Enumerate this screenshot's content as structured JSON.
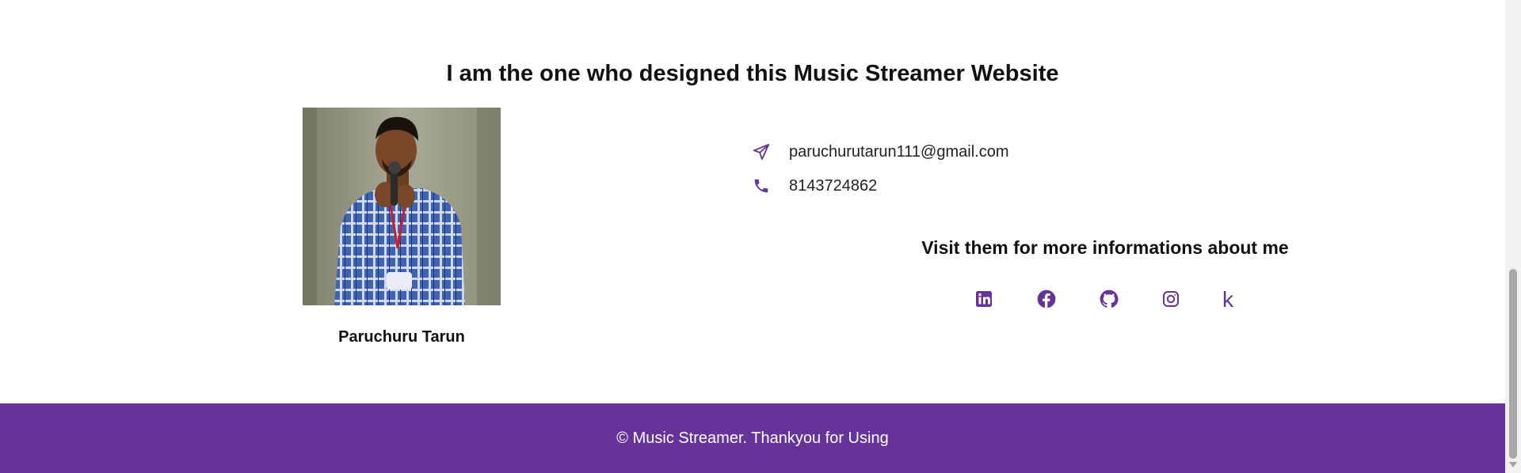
{
  "about": {
    "heading": "I am the one who designed this Music Streamer Website",
    "name": "Paruchuru Tarun"
  },
  "contact": {
    "email": "paruchurutarun111@gmail.com",
    "phone": "8143724862",
    "email_icon": "paper-plane-icon",
    "phone_icon": "phone-icon"
  },
  "social": {
    "heading": "Visit them for more informations about me",
    "links": [
      {
        "icon": "linkedin-icon"
      },
      {
        "icon": "facebook-icon"
      },
      {
        "icon": "github-icon"
      },
      {
        "icon": "instagram-icon"
      },
      {
        "icon": "kaggle-icon",
        "glyph": "k"
      }
    ]
  },
  "footer": {
    "text": "© Music Streamer. Thankyou for Using"
  },
  "colors": {
    "accent": "#663399",
    "footer_text": "#ffffff"
  }
}
